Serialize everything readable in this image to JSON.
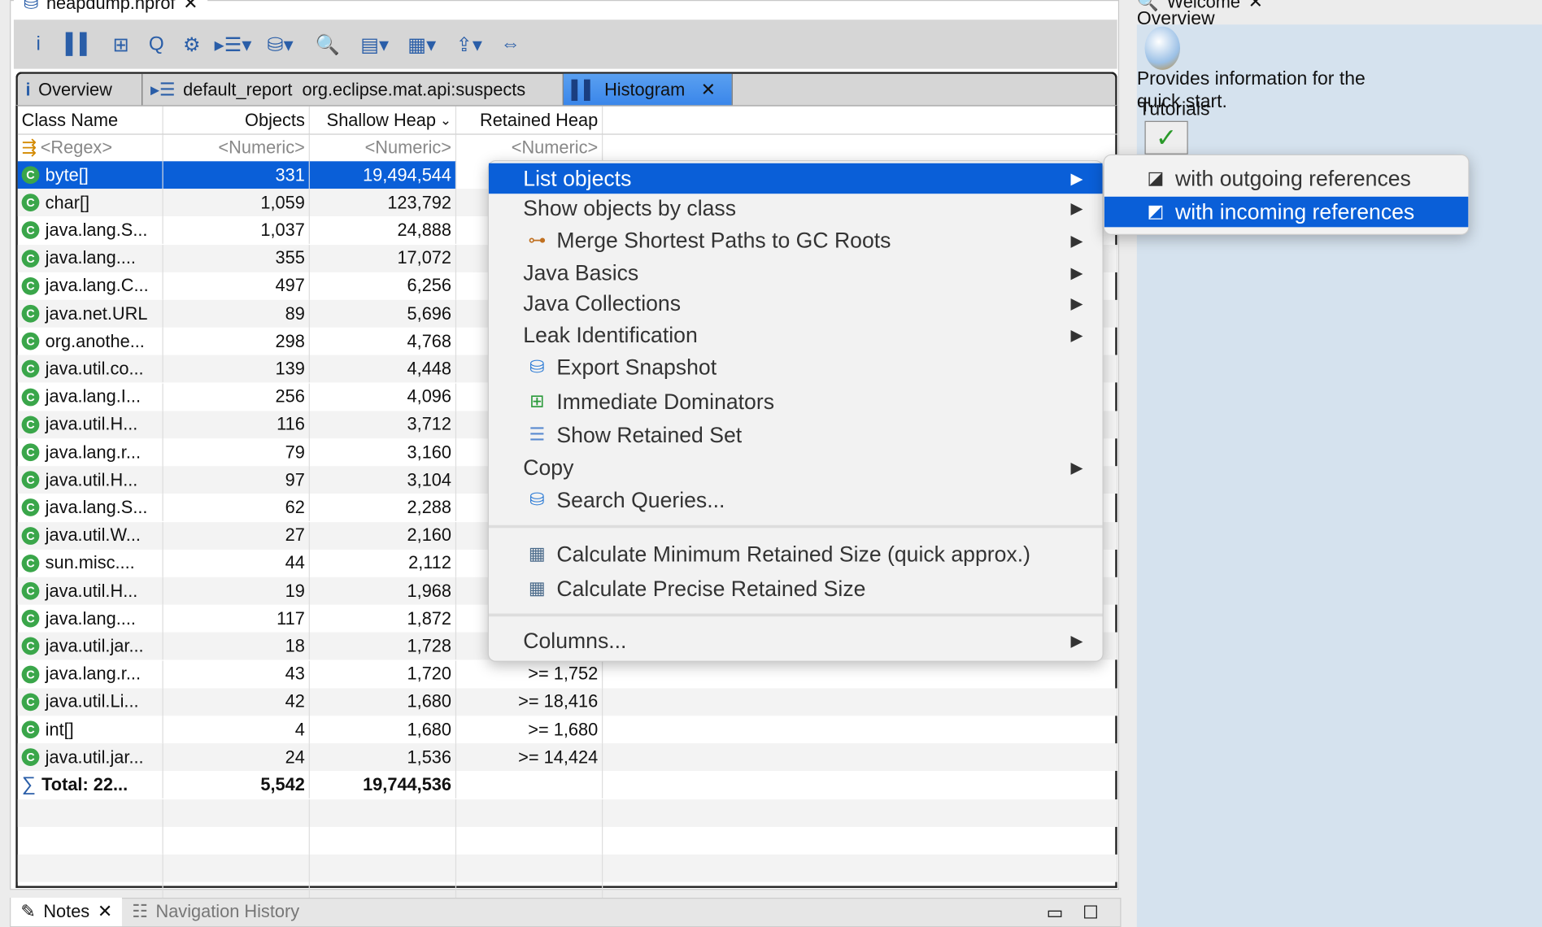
{
  "editor_tab": {
    "title": "heapdump.hprof"
  },
  "toolbar": {
    "icons": [
      "info-icon",
      "histogram-icon",
      "dominator-tree-icon",
      "oql-icon",
      "heap-dump-overview-icon",
      "run-report-icon",
      "query-browser-icon",
      "search-icon",
      "group-icon",
      "calculate-icon",
      "export-icon",
      "compare-icon"
    ]
  },
  "tabs": [
    {
      "label": "Overview"
    },
    {
      "label": "default_report  org.eclipse.mat.api:suspects"
    },
    {
      "label": "Histogram",
      "active": true
    }
  ],
  "table": {
    "columns": [
      "Class Name",
      "Objects",
      "Shallow Heap",
      "Retained Heap"
    ],
    "sort_indicator": "⌄",
    "filters": [
      "<Regex>",
      "<Numeric>",
      "<Numeric>",
      "<Numeric>"
    ],
    "rows": [
      {
        "name": "byte[]",
        "objects": "331",
        "shallow": "19,494,544",
        "retained": ">="
      },
      {
        "name": "char[]",
        "objects": "1,059",
        "shallow": "123,792",
        "retained": ""
      },
      {
        "name": "java.lang.S...",
        "objects": "1,037",
        "shallow": "24,888",
        "retained": ""
      },
      {
        "name": "java.lang....",
        "objects": "355",
        "shallow": "17,072",
        "retained": ">="
      },
      {
        "name": "java.lang.C...",
        "objects": "497",
        "shallow": "6,256",
        "retained": ">="
      },
      {
        "name": "java.net.URL",
        "objects": "89",
        "shallow": "5,696",
        "retained": ""
      },
      {
        "name": "org.anothe...",
        "objects": "298",
        "shallow": "4,768",
        "retained": ">="
      },
      {
        "name": "java.util.co...",
        "objects": "139",
        "shallow": "4,448",
        "retained": ""
      },
      {
        "name": "java.lang.I...",
        "objects": "256",
        "shallow": "4,096",
        "retained": ""
      },
      {
        "name": "java.util.H...",
        "objects": "116",
        "shallow": "3,712",
        "retained": ""
      },
      {
        "name": "java.lang.r...",
        "objects": "79",
        "shallow": "3,160",
        "retained": ""
      },
      {
        "name": "java.util.H...",
        "objects": "97",
        "shallow": "3,104",
        "retained": ""
      },
      {
        "name": "java.lang.S...",
        "objects": "62",
        "shallow": "2,288",
        "retained": ""
      },
      {
        "name": "java.util.W...",
        "objects": "27",
        "shallow": "2,160",
        "retained": ""
      },
      {
        "name": "sun.misc....",
        "objects": "44",
        "shallow": "2,112",
        "retained": ""
      },
      {
        "name": "java.util.H...",
        "objects": "19",
        "shallow": "1,968",
        "retained": ""
      },
      {
        "name": "java.lang....",
        "objects": "117",
        "shallow": "1,872",
        "retained": ""
      },
      {
        "name": "java.util.jar...",
        "objects": "18",
        "shallow": "1,728",
        "retained": ""
      },
      {
        "name": "java.lang.r...",
        "objects": "43",
        "shallow": "1,720",
        "retained": ">= 1,752"
      },
      {
        "name": "java.util.Li...",
        "objects": "42",
        "shallow": "1,680",
        "retained": ">= 18,416"
      },
      {
        "name": "int[]",
        "objects": "4",
        "shallow": "1,680",
        "retained": ">= 1,680"
      },
      {
        "name": "java.util.jar...",
        "objects": "24",
        "shallow": "1,536",
        "retained": ">= 14,424"
      }
    ],
    "total": {
      "name": "Total: 22...",
      "objects": "5,542",
      "shallow": "19,744,536"
    }
  },
  "context_menu": {
    "items": [
      {
        "label": "List objects",
        "submenu": true,
        "highlighted": true
      },
      {
        "label": "Show objects by class",
        "submenu": true
      },
      {
        "label": "Merge Shortest Paths to GC Roots",
        "submenu": true,
        "icon": "merge-paths-icon"
      },
      {
        "label": "Java Basics",
        "submenu": true
      },
      {
        "label": "Java Collections",
        "submenu": true
      },
      {
        "label": "Leak Identification",
        "submenu": true
      },
      {
        "label": "Export Snapshot",
        "icon": "export-snapshot-icon"
      },
      {
        "label": "Immediate Dominators",
        "icon": "immediate-dominators-icon"
      },
      {
        "label": "Show Retained Set",
        "icon": "retained-set-icon"
      },
      {
        "label": "Copy",
        "submenu": true
      },
      {
        "label": "Search Queries...",
        "icon": "search-queries-icon"
      },
      {
        "label": "Calculate Minimum Retained Size (quick approx.)",
        "icon": "calculator-icon"
      },
      {
        "label": "Calculate Precise Retained Size",
        "icon": "calculator-icon"
      },
      {
        "label": "Columns...",
        "submenu": true
      }
    ]
  },
  "submenu": {
    "items": [
      {
        "label": "with outgoing references"
      },
      {
        "label": "with incoming references",
        "highlighted": true
      }
    ]
  },
  "welcome": {
    "tab": "Welcome",
    "overview": "Overview",
    "description": "Provides information for the quick start.",
    "tutorials": "Tutorials"
  },
  "bottom": {
    "tabs": [
      "Notes",
      "Navigation History"
    ]
  },
  "colors": {
    "selection": "#0a5fd8",
    "class_icon": "#3aa64a",
    "welcome_bg": "#d5e2ee"
  }
}
